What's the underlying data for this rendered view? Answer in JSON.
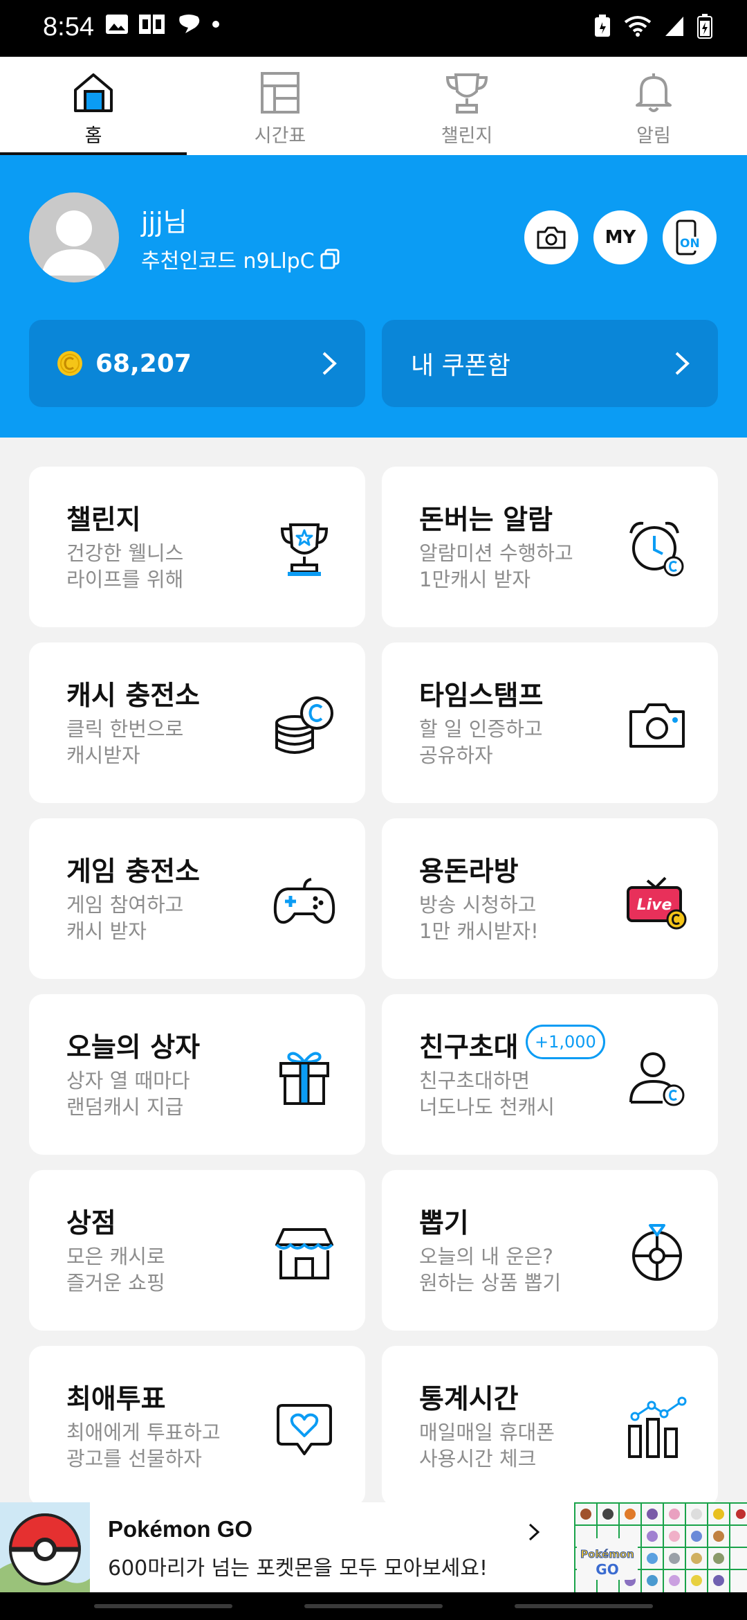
{
  "status_bar": {
    "time": "8:54"
  },
  "tabs": [
    {
      "label": "홈",
      "icon": "home-icon",
      "active": true
    },
    {
      "label": "시간표",
      "icon": "timetable-icon"
    },
    {
      "label": "챌린지",
      "icon": "trophy-icon"
    },
    {
      "label": "알림",
      "icon": "bell-icon"
    }
  ],
  "profile": {
    "name": "jjj님",
    "referral": "추천인코드 n9LlpC",
    "buttons": {
      "camera": "camera-icon",
      "my": "MY",
      "on": "ON"
    }
  },
  "wallet": {
    "cash": "68,207",
    "coupon": "내 쿠폰함"
  },
  "cards": [
    {
      "title": "챌린지",
      "sub": "건강한 웰니스\n라이프를 위해",
      "icon": "trophy-icon"
    },
    {
      "title": "돈버는 알람",
      "sub": "알람미션 수행하고\n1만캐시 받자",
      "icon": "alarm-clock-icon"
    },
    {
      "title": "캐시 충전소",
      "sub": "클릭 한번으로\n캐시받자",
      "icon": "coin-stack-icon"
    },
    {
      "title": "타임스탬프",
      "sub": "할 일 인증하고\n공유하자",
      "icon": "camera-icon"
    },
    {
      "title": "게임 충전소",
      "sub": "게임 참여하고\n캐시 받자",
      "icon": "gamepad-icon"
    },
    {
      "title": "용돈라방",
      "sub": "방송 시청하고\n1만 캐시받자!",
      "icon": "live-tv-icon",
      "live": "Live"
    },
    {
      "title": "오늘의 상자",
      "sub": "상자 열 때마다\n랜덤캐시 지급",
      "icon": "gift-box-icon"
    },
    {
      "title": "친구초대",
      "sub": "친구초대하면\n너도나도 천캐시",
      "icon": "invite-friend-icon",
      "badge": "+1,000"
    },
    {
      "title": "상점",
      "sub": "모은 캐시로\n즐거운 쇼핑",
      "icon": "store-icon"
    },
    {
      "title": "뽑기",
      "sub": "오늘의 내 운은?\n원하는 상품 뽑기",
      "icon": "roulette-icon"
    },
    {
      "title": "최애투표",
      "sub": "최애에게 투표하고\n광고를 선물하자",
      "icon": "heart-vote-icon"
    },
    {
      "title": "통계시간",
      "sub": "매일매일 휴대폰\n사용시간 체크",
      "icon": "statistics-icon"
    }
  ],
  "ad": {
    "title": "Pokémon GO",
    "desc": "600마리가 넘는 포켓몬을 모두 모아보세요!",
    "logo_text": "Pokémon GO"
  },
  "colors": {
    "primary": "#0b9cf4",
    "primary_dark": "#0a86d8",
    "coin": "#f5c518"
  }
}
